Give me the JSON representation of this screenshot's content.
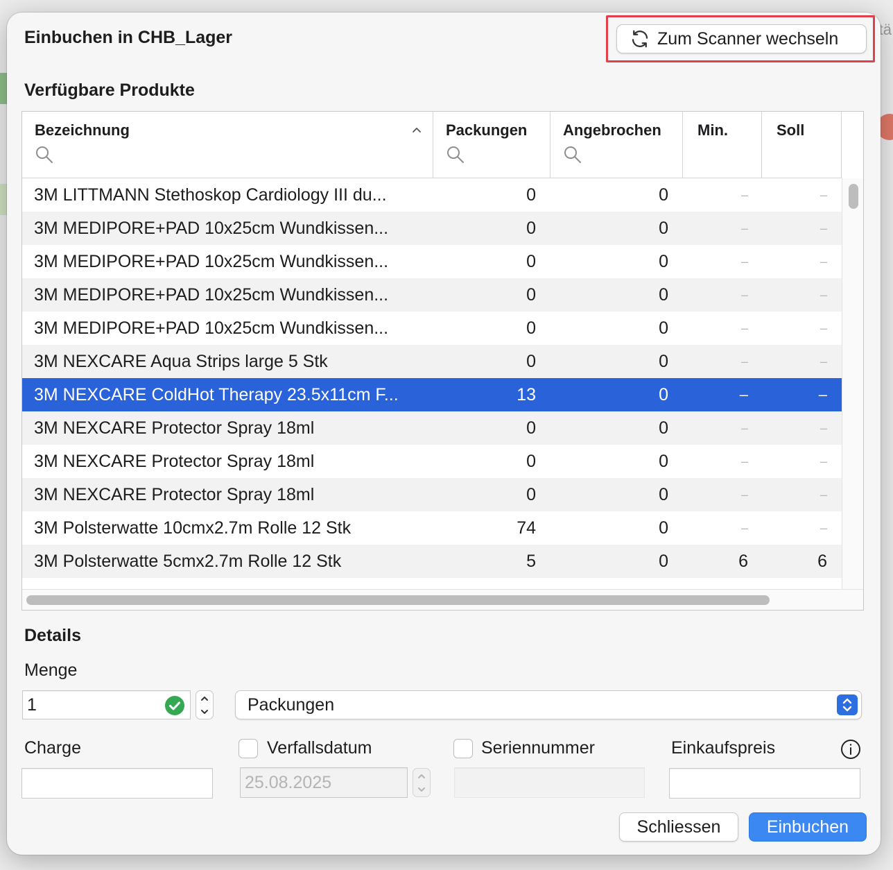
{
  "dialog": {
    "title": "Einbuchen in CHB_Lager",
    "scanner_button": "Zum Scanner wechseln",
    "products_heading": "Verfügbare Produkte",
    "details_heading": "Details"
  },
  "background": {
    "partial_text": "tä"
  },
  "table": {
    "columns": {
      "name": "Bezeichnung",
      "packs": "Packungen",
      "opened": "Angebrochen",
      "min": "Min.",
      "target": "Soll"
    },
    "rows": [
      {
        "name": "3M LITTMANN Stethoskop Cardiology III du...",
        "packs": "0",
        "opened": "0",
        "min": "–",
        "target": "–"
      },
      {
        "name": "3M MEDIPORE+PAD 10x25cm Wundkissen...",
        "packs": "0",
        "opened": "0",
        "min": "–",
        "target": "–"
      },
      {
        "name": "3M MEDIPORE+PAD 10x25cm Wundkissen...",
        "packs": "0",
        "opened": "0",
        "min": "–",
        "target": "–"
      },
      {
        "name": "3M MEDIPORE+PAD 10x25cm Wundkissen...",
        "packs": "0",
        "opened": "0",
        "min": "–",
        "target": "–"
      },
      {
        "name": "3M MEDIPORE+PAD 10x25cm Wundkissen...",
        "packs": "0",
        "opened": "0",
        "min": "–",
        "target": "–"
      },
      {
        "name": "3M NEXCARE Aqua Strips large 5 Stk",
        "packs": "0",
        "opened": "0",
        "min": "–",
        "target": "–"
      },
      {
        "name": "3M NEXCARE ColdHot Therapy 23.5x11cm F...",
        "packs": "13",
        "opened": "0",
        "min": "–",
        "target": "–"
      },
      {
        "name": "3M NEXCARE Protector Spray 18ml",
        "packs": "0",
        "opened": "0",
        "min": "–",
        "target": "–"
      },
      {
        "name": "3M NEXCARE Protector Spray 18ml",
        "packs": "0",
        "opened": "0",
        "min": "–",
        "target": "–"
      },
      {
        "name": "3M NEXCARE Protector Spray 18ml",
        "packs": "0",
        "opened": "0",
        "min": "–",
        "target": "–"
      },
      {
        "name": "3M Polsterwatte 10cmx2.7m Rolle 12 Stk",
        "packs": "74",
        "opened": "0",
        "min": "–",
        "target": "–"
      },
      {
        "name": "3M Polsterwatte 5cmx2.7m Rolle 12 Stk",
        "packs": "5",
        "opened": "0",
        "min": "6",
        "target": "6"
      }
    ],
    "selected_index": 6
  },
  "details": {
    "quantity_label": "Menge",
    "quantity_value": "1",
    "unit_value": "Packungen",
    "batch_label": "Charge",
    "batch_value": "",
    "expiry_label": "Verfallsdatum",
    "expiry_value": "25.08.2025",
    "serial_label": "Seriennummer",
    "serial_value": "",
    "price_label": "Einkaufspreis",
    "price_value": ""
  },
  "buttons": {
    "close": "Schliessen",
    "book": "Einbuchen"
  },
  "colors": {
    "selection": "#2a63d9",
    "primary": "#3b88f2",
    "highlight": "#e0404a",
    "valid": "#34a853"
  }
}
